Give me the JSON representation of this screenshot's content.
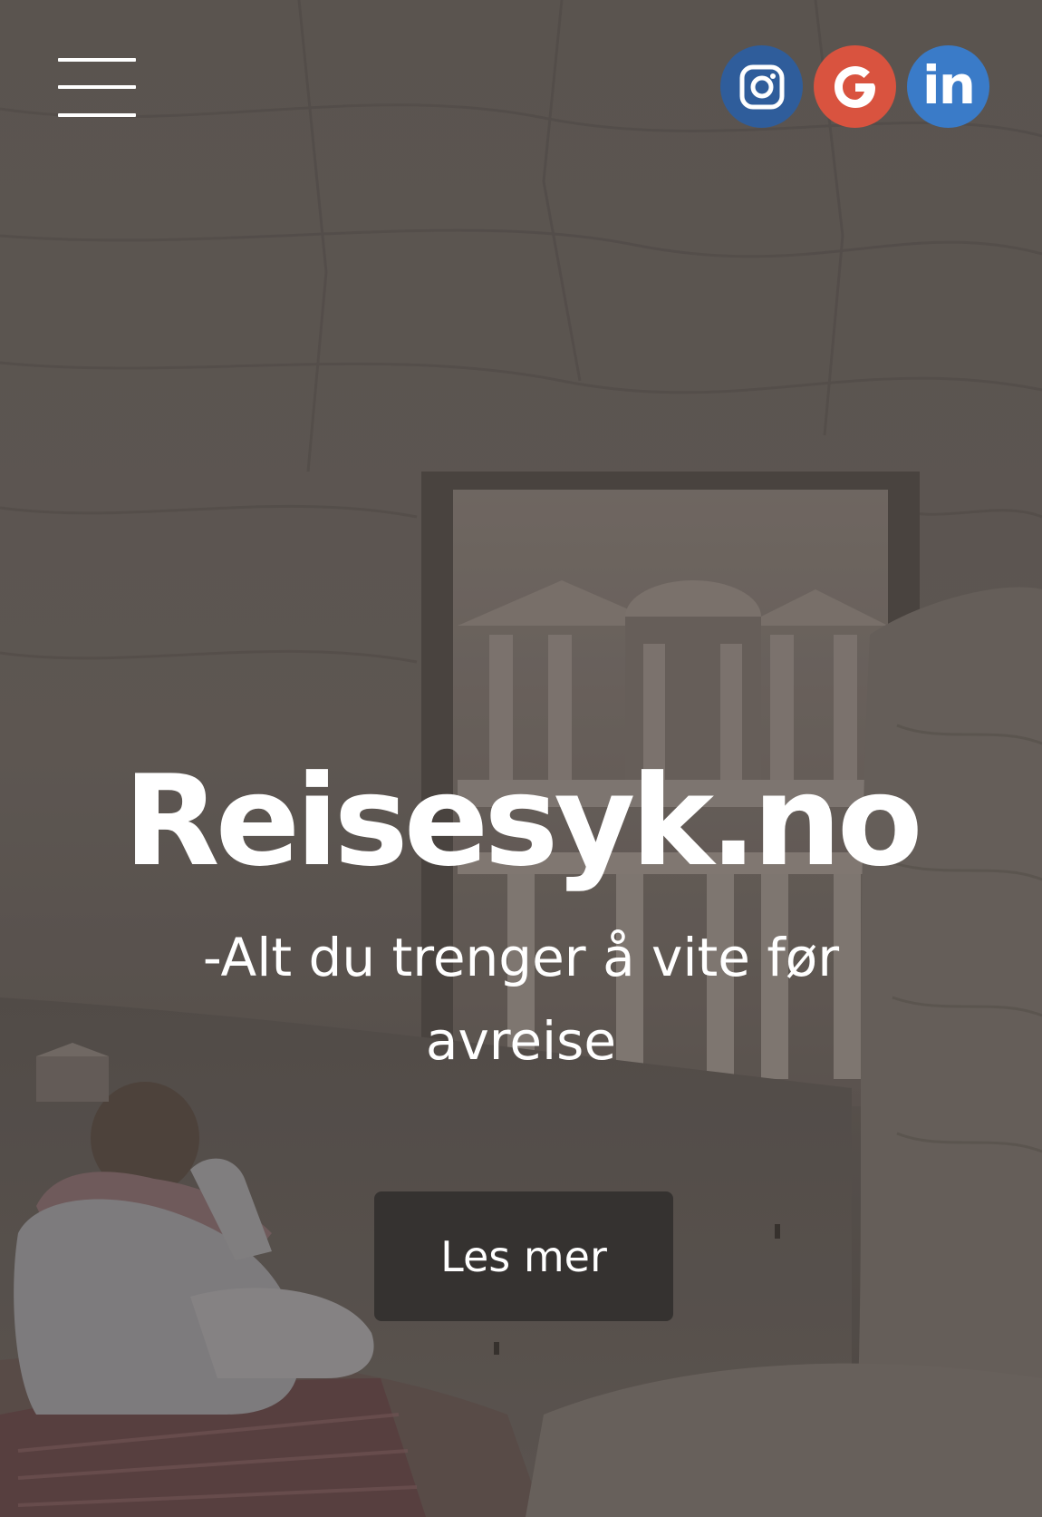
{
  "header": {
    "menu_icon": "hamburger-menu-icon",
    "social_links": [
      {
        "name": "instagram",
        "icon": "instagram-icon",
        "color": "#2f5d9b"
      },
      {
        "name": "google",
        "icon": "google-icon",
        "color": "#d9533f"
      },
      {
        "name": "linkedin",
        "icon": "linkedin-icon",
        "label": "in",
        "color": "#3a7bc8"
      }
    ]
  },
  "hero": {
    "title": "Reisesyk.no",
    "subtitle": "-Alt du trenger å vite før avreise",
    "cta_label": "Les mer",
    "background_image": "petra-treasury-photo"
  },
  "colors": {
    "button_bg": "#353230",
    "text": "#ffffff"
  }
}
